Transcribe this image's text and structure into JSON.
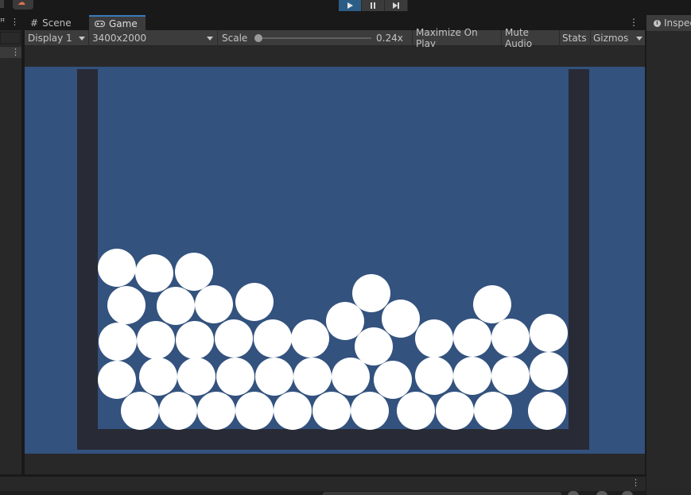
{
  "toolbar": {
    "play_state": "playing",
    "buttons": [
      "play",
      "pause",
      "step"
    ]
  },
  "tabs": [
    {
      "label": "Scene",
      "icon": "grid-icon"
    },
    {
      "label": "Game",
      "icon": "gamepad-icon"
    }
  ],
  "game_controls": {
    "display": "Display 1",
    "resolution": "3400x2000",
    "scale_label": "Scale",
    "scale_value": "0.24x",
    "scale_fraction": 0.0,
    "maximize": "Maximize On Play",
    "mute": "Mute Audio",
    "stats": "Stats",
    "gizmos": "Gizmos"
  },
  "inspector": {
    "title": "Inspector"
  },
  "colors": {
    "sky": "#33527e",
    "container": "#282a35",
    "ball": "#ffffff",
    "accent": "#2c5d87",
    "active_tab_border": "#3a79bb"
  },
  "scene": {
    "object_count": 42
  }
}
